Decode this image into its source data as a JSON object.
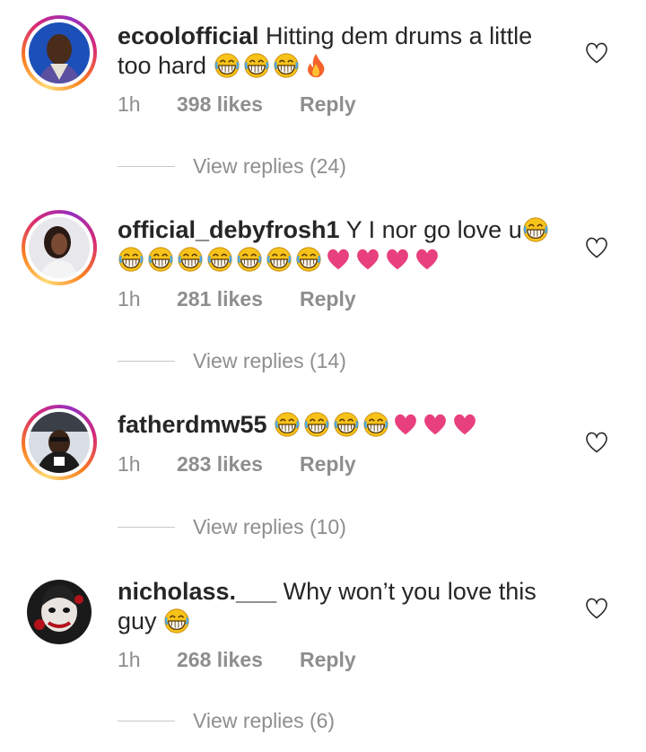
{
  "comments": [
    {
      "username": "ecoolofficial",
      "text": "Hitting dem drums a little too hard",
      "emojis": "😂😂😂🔥",
      "time": "1h",
      "likes": "398 likes",
      "reply": "Reply",
      "view_replies": "View replies (24)"
    },
    {
      "username": "official_debyfrosh1",
      "text": "Y I nor go love u",
      "emojis": "😂😂😂😂😂😂😂😂💗💗💗💗",
      "time": "1h",
      "likes": "281 likes",
      "reply": "Reply",
      "view_replies": "View replies (14)"
    },
    {
      "username": "fatherdmw55",
      "text": "",
      "emojis": "😂😂😂😂💗💗💗",
      "time": "1h",
      "likes": "283 likes",
      "reply": "Reply",
      "view_replies": "View replies (10)"
    },
    {
      "username": "nicholass.___",
      "text": "Why won’t you love this guy",
      "emojis": "😂",
      "time": "1h",
      "likes": "268 likes",
      "reply": "Reply",
      "view_replies": "View replies (6)"
    }
  ],
  "icons": {
    "like": "heart-outline-icon",
    "laugh": "tears-of-joy-emoji",
    "fire": "fire-emoji",
    "pink_heart": "pink-heart-emoji"
  },
  "colors": {
    "text": "#262626",
    "meta": "#8e8e8e",
    "emoji_face": "#f7c31a",
    "pink_heart": "#e8407e",
    "fire": "#f5622a"
  }
}
